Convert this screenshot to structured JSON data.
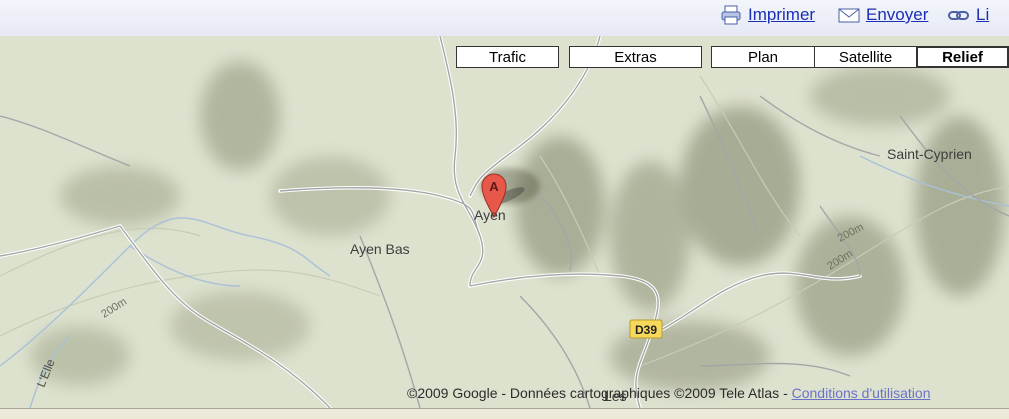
{
  "toolbar": {
    "print_label": "Imprimer",
    "send_label": "Envoyer",
    "link_label": "Li"
  },
  "map_types": {
    "traffic": "Trafic",
    "extras": "Extras",
    "plan": "Plan",
    "satellite": "Satellite",
    "relief": "Relief",
    "active": "Relief"
  },
  "map": {
    "marker_letter": "A",
    "places": {
      "ayen": "Ayen",
      "ayen_bas": "Ayen Bas",
      "saint_cyprien": "Saint-Cyprien",
      "les": "Les"
    },
    "contours": {
      "left": "200m",
      "middle": "200m",
      "right": "200m"
    },
    "river": "L'Elle",
    "road": "D39"
  },
  "footer": {
    "copyright": "©2009 Google - Données cartographiques ©2009 Tele Atlas - ",
    "terms_link": "Conditions d'utilisation"
  },
  "colors": {
    "land": "#dde2cf",
    "link": "#1a2fb5",
    "road_label_bg": "#f6d95b",
    "marker": "#e8584a"
  }
}
